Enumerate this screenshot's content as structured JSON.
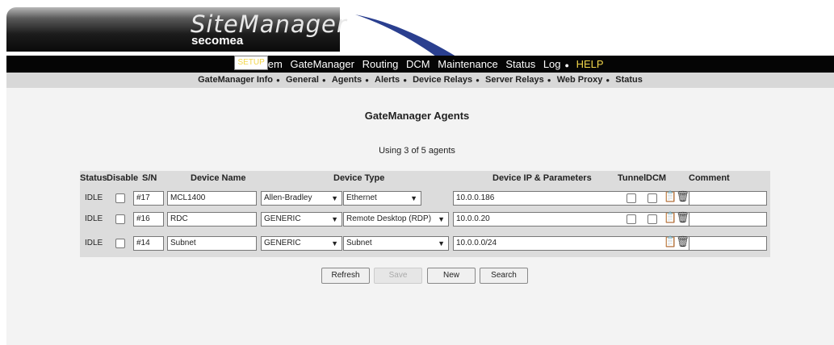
{
  "logo": {
    "title": "SiteManager",
    "brand": "secomea"
  },
  "topnav": {
    "setup": "SETUP",
    "system": "System",
    "gatemanager": "GateManager",
    "routing": "Routing",
    "dcm": "DCM",
    "maintenance": "Maintenance",
    "status": "Status",
    "log": "Log",
    "help": "HELP"
  },
  "subnav": {
    "gm_info": "GateManager Info",
    "general": "General",
    "agents": "Agents",
    "alerts": "Alerts",
    "device_relays": "Device Relays",
    "server_relays": "Server Relays",
    "web_proxy": "Web Proxy",
    "status": "Status"
  },
  "page": {
    "title": "GateManager Agents",
    "usage": "Using 3 of 5 agents"
  },
  "table": {
    "headers": {
      "status": "Status",
      "disable": "Disable",
      "sn": "S/N",
      "device_name": "Device Name",
      "device_type": "Device Type",
      "ip": "Device IP & Parameters",
      "tunnel": "Tunnel",
      "dcm": "DCM",
      "comment": "Comment"
    },
    "rows": [
      {
        "status": "IDLE",
        "sn": "#17",
        "name": "MCL1400",
        "vendor": "Allen-Bradley",
        "type": "Ethernet",
        "ip": "10.0.0.186",
        "comment": ""
      },
      {
        "status": "IDLE",
        "sn": "#16",
        "name": "RDC",
        "vendor": "GENERIC",
        "type": "Remote Desktop (RDP)",
        "ip": "10.0.0.20",
        "comment": ""
      },
      {
        "status": "IDLE",
        "sn": "#14",
        "name": "Subnet",
        "vendor": "GENERIC",
        "type": "Subnet",
        "ip": "10.0.0.0/24",
        "comment": ""
      }
    ]
  },
  "buttons": {
    "refresh": "Refresh",
    "save": "Save",
    "new": "New",
    "search": "Search"
  },
  "colors": {
    "accent": "#f2d64a",
    "nav_bg": "#050505",
    "subnav_bg": "#d8d8d8",
    "table_bg": "#dcdcdc"
  }
}
